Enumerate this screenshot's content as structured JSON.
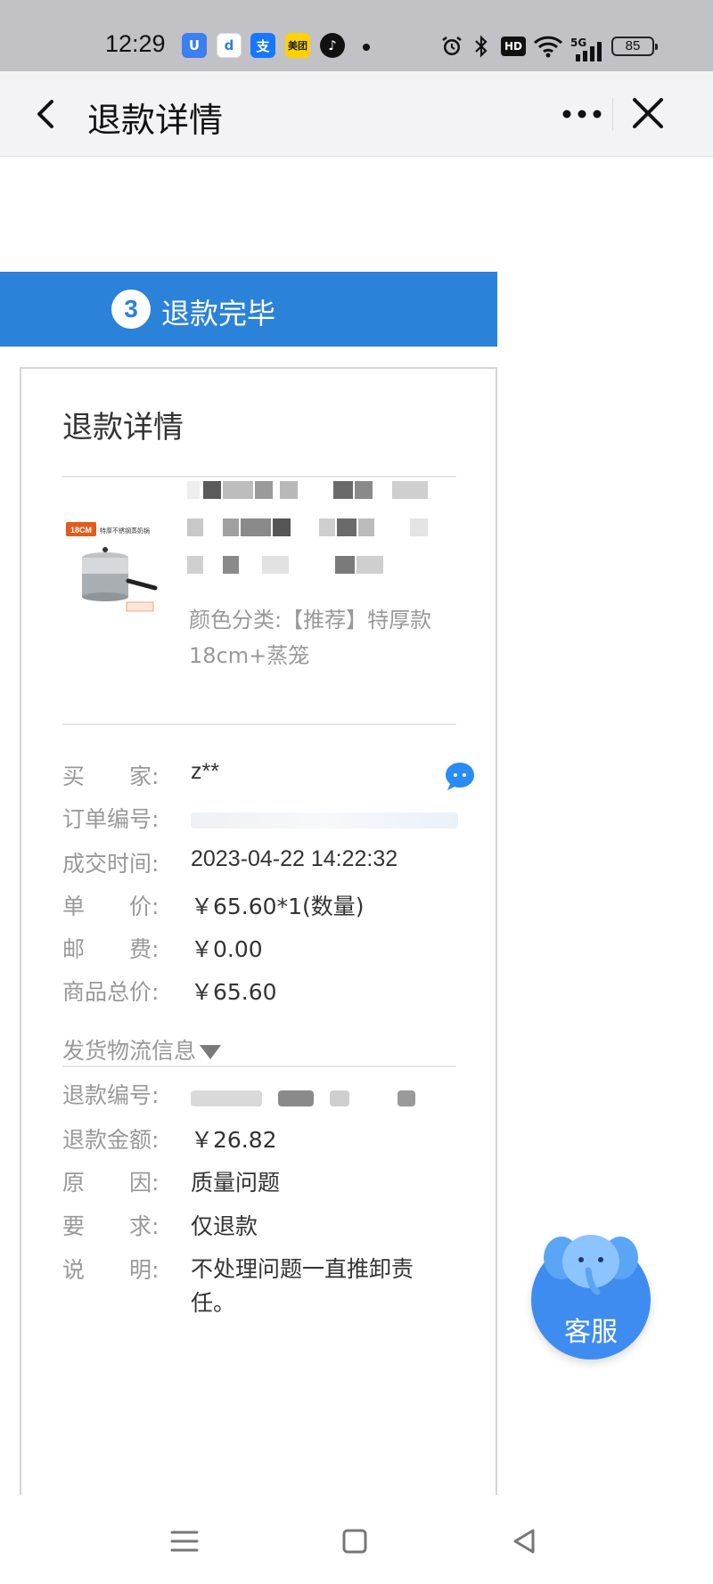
{
  "status_bar": {
    "time": "12:29",
    "apps": [
      "u-app-icon",
      "d-app-icon",
      "alipay-icon",
      "meituan-icon",
      "tiktok-icon"
    ],
    "meituan_label": "美团",
    "battery": "85",
    "hd_label": "HD",
    "net_label": "5G"
  },
  "nav": {
    "title": "退款详情"
  },
  "step": {
    "number": "3",
    "label": "退款完毕"
  },
  "panel": {
    "title": "退款详情",
    "product": {
      "sku": "颜色分类:【推荐】特厚款18cm+蒸笼",
      "thumb_badge": "18CM",
      "thumb_caption": "特厚不锈钢蒸奶锅"
    },
    "rows": [
      {
        "label": "买　　家:",
        "value": "z**"
      },
      {
        "label": "订单编号:",
        "value": ""
      },
      {
        "label": "成交时间:",
        "value": "2023-04-22 14:22:32"
      },
      {
        "label": "单　　价:",
        "value": "￥65.60*1(数量)"
      },
      {
        "label": "邮　　费:",
        "value": "￥0.00"
      },
      {
        "label": "商品总价:",
        "value": "￥65.60"
      }
    ],
    "logistics": "发货物流信息",
    "refund_rows": [
      {
        "label": "退款编号:",
        "value": ""
      },
      {
        "label": "退款金额:",
        "value": "￥26.82"
      },
      {
        "label": "原　　因:",
        "value": "质量问题"
      },
      {
        "label": "要　　求:",
        "value": "仅退款"
      },
      {
        "label": "说　　明:",
        "value": "不处理问题一直推卸责任。"
      }
    ]
  },
  "customer_service": {
    "label": "客服"
  },
  "colors": {
    "accent": "#2b82d9",
    "cs_blue": "#3f8cf0",
    "label_gray": "#999999"
  }
}
